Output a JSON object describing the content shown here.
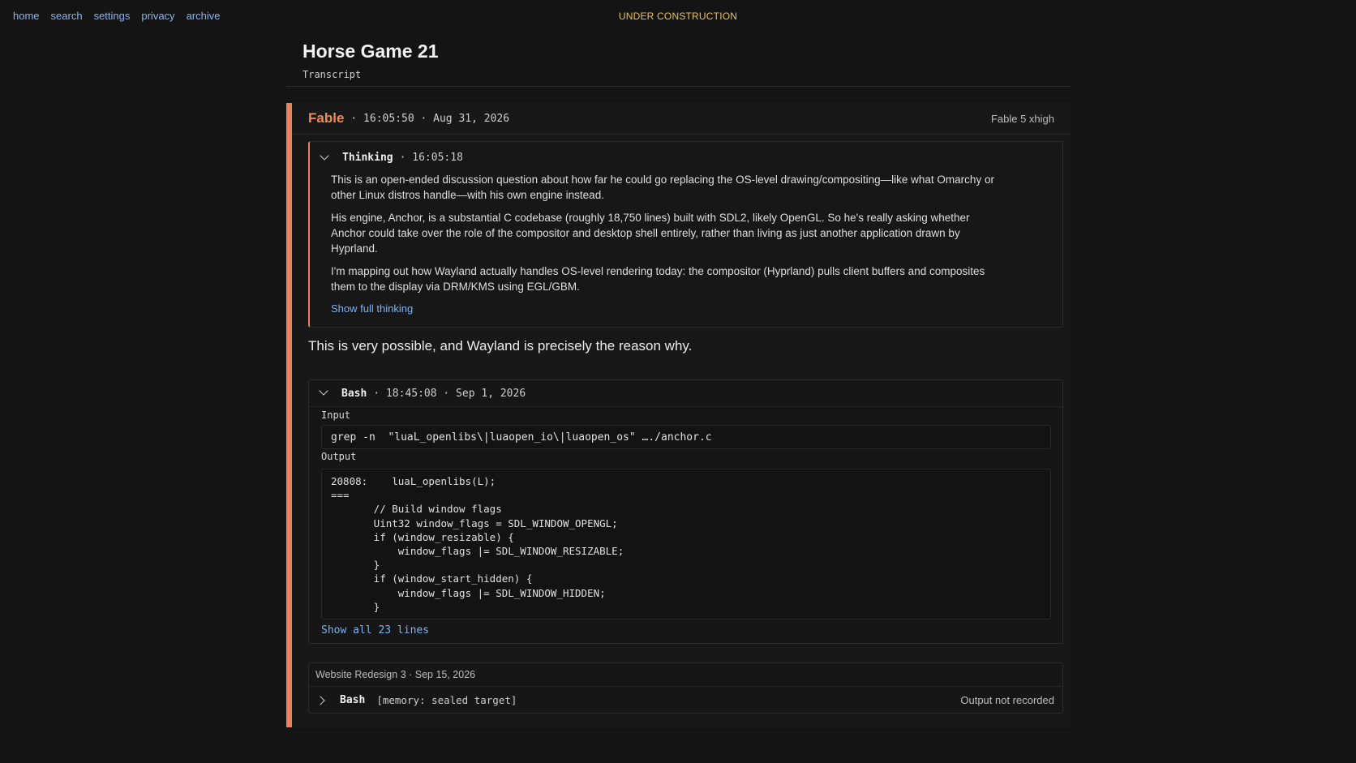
{
  "nav": [
    "home",
    "search",
    "settings",
    "privacy",
    "archive"
  ],
  "banner": "UNDER CONSTRUCTION",
  "page": {
    "title": "Horse Game 21",
    "subtitle": "Transcript"
  },
  "turn": {
    "speaker": "Fable",
    "meta": "· 16:05:50 · Aug 31, 2026",
    "model": "Fable 5 xhigh",
    "thinking": {
      "title": "Thinking",
      "time": "· 16:05:18",
      "paragraphs": [
        "This is an open-ended discussion question about how far he could go replacing the OS-level drawing/compositing—like what Omarchy or other Linux distros handle—with his own engine instead.",
        "His engine, Anchor, is a substantial C codebase (roughly 18,750 lines) built with SDL2, likely OpenGL. So he's really asking whether Anchor could take over the role of the compositor and desktop shell entirely, rather than living as just another application drawn by Hyprland.",
        "I'm mapping out how Wayland actually handles OS-level rendering today: the compositor (Hyprland) pulls client buffers and composites them to the display via DRM/KMS using EGL/GBM."
      ],
      "show_label": "Show full thinking"
    },
    "answer": "This is very possible, and Wayland is precisely the reason why.",
    "tool": {
      "name": "Bash",
      "meta": "· 18:45:08 · Sep 1, 2026",
      "input_label": "Input",
      "input": "grep -n  \"luaL_openlibs\\|luaopen_io\\|luaopen_os\" …./anchor.c",
      "output_label": "Output",
      "output": "20808:    luaL_openlibs(L);\n===\n       // Build window flags\n       Uint32 window_flags = SDL_WINDOW_OPENGL;\n       if (window_resizable) {\n           window_flags |= SDL_WINDOW_RESIZABLE;\n       }\n       if (window_start_hidden) {\n           window_flags |= SDL_WINDOW_HIDDEN;\n       }",
      "show_all": "Show all 23 lines"
    },
    "ref": {
      "header": "Website Redesign 3 · Sep 15, 2026",
      "tool": "Bash",
      "arg": "[memory: sealed target]",
      "status": "Output not recorded"
    }
  }
}
